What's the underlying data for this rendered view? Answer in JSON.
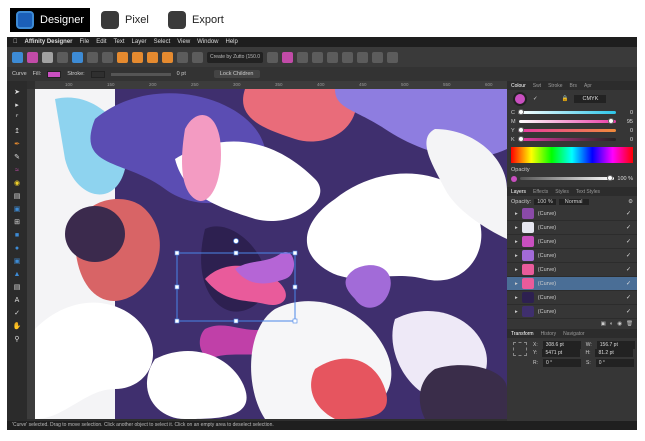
{
  "personas": [
    {
      "label": "Designer",
      "active": true
    },
    {
      "label": "Pixel",
      "active": false
    },
    {
      "label": "Export",
      "active": false
    }
  ],
  "menubar": {
    "app_name": "Affinity Designer",
    "items": [
      "File",
      "Edit",
      "Text",
      "Layer",
      "Select",
      "View",
      "Window",
      "Help"
    ]
  },
  "toolbar": {
    "dropdown_label": "Create by Zutto (150.0"
  },
  "context": {
    "tool": "Curve",
    "fill_label": "Fill:",
    "stroke_label": "Stroke:",
    "stroke_width": "0 pt",
    "lock_children": "Lock Children"
  },
  "ruler_ticks": [
    "100",
    "150",
    "200",
    "250",
    "300",
    "350",
    "400",
    "450",
    "500",
    "550",
    "600"
  ],
  "colour_panel": {
    "tabs": [
      "Colour",
      "Swt",
      "Stroke",
      "Brs",
      "Apr"
    ],
    "model": "CMYK",
    "channels": [
      {
        "key": "C",
        "value": "0",
        "color": "#2cc5e8"
      },
      {
        "key": "M",
        "value": "95",
        "color": "#e83aa4"
      },
      {
        "key": "Y",
        "value": "0",
        "color": "#f0d12a"
      },
      {
        "key": "K",
        "value": "0",
        "color": "#777777"
      }
    ],
    "opacity_label": "Opacity",
    "opacity_value": "100 %"
  },
  "layers_panel": {
    "tabs": [
      "Layers",
      "Effects",
      "Styles",
      "Text Styles"
    ],
    "opacity_label": "Opacity:",
    "opacity_value": "100 %",
    "blend_mode": "Normal",
    "rows": [
      {
        "name": "(Curve)",
        "selected": false
      },
      {
        "name": "(Curve)",
        "selected": false
      },
      {
        "name": "(Curve)",
        "selected": false
      },
      {
        "name": "(Curve)",
        "selected": false
      },
      {
        "name": "(Curve)",
        "selected": false
      },
      {
        "name": "(Curve)",
        "selected": true
      },
      {
        "name": "(Curve)",
        "selected": false
      },
      {
        "name": "(Curve)",
        "selected": false
      }
    ]
  },
  "transform_panel": {
    "tabs": [
      "Transform",
      "History",
      "Navigator"
    ],
    "x_label": "X:",
    "x_value": "308.6 pt",
    "y_label": "Y:",
    "y_value": "5471 pt",
    "w_label": "W:",
    "w_value": "156.7 pt",
    "h_label": "H:",
    "h_value": "81.2 pt",
    "r_label": "R:",
    "r_value": "0 °",
    "s_label": "S:",
    "s_value": "0 °"
  },
  "status": {
    "text": "'Curve' selected. Drag to move selection. Click another object to select it. Click on an empty area to deselect selection."
  }
}
